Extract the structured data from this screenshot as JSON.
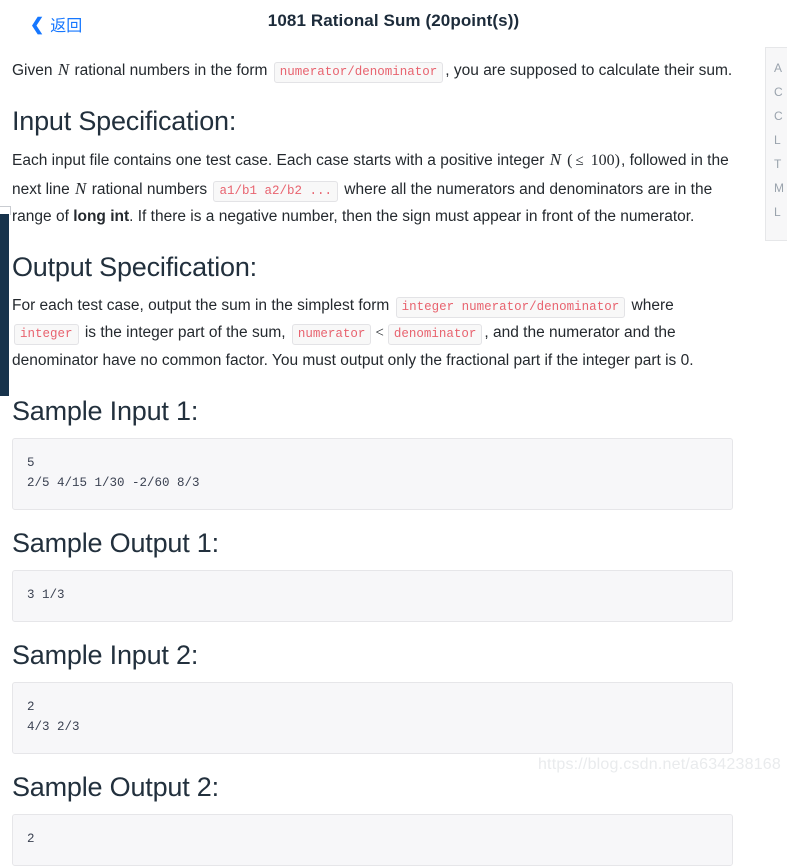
{
  "header": {
    "back_label": "返回",
    "back_icon": "chevron-left-icon",
    "title": "1081 Rational Sum (20point(s))"
  },
  "right_panel": {
    "items": [
      "A",
      "C",
      "C",
      "L",
      "T",
      "M",
      "L"
    ]
  },
  "content": {
    "intro": {
      "p1_a": "Given ",
      "p1_n": "N",
      "p1_b": " rational numbers in the form ",
      "p1_code": "numerator/denominator",
      "p1_c": ", you are supposed to calculate their sum."
    },
    "input_spec": {
      "heading": "Input Specification:",
      "a": "Each input file contains one test case. Each case starts with a positive integer ",
      "n1": "N",
      "b": " (",
      "le": "≤",
      "limit": " 100)",
      "c": ", followed in the next line ",
      "n2": "N",
      "d": " rational numbers ",
      "code": "a1/b1 a2/b2 ...",
      "e": " where all the numerators and denominators are in the range of ",
      "strong": "long int",
      "f": ". If there is a negative number, then the sign must appear in front of the numerator."
    },
    "output_spec": {
      "heading": "Output Specification:",
      "a": "For each test case, output the sum in the simplest form ",
      "code1": "integer numerator/denominator",
      "b": " where ",
      "code2": "integer",
      "c": " is the integer part of the sum, ",
      "code3": "numerator",
      "lt": "<",
      "code4": "denominator",
      "d": ", and the numerator and the denominator have no common factor. You must output only the fractional part if the integer part is 0."
    },
    "samples": [
      {
        "heading": "Sample Input 1:",
        "code": "5\n2/5 4/15 1/30 -2/60 8/3"
      },
      {
        "heading": "Sample Output 1:",
        "code": "3 1/3"
      },
      {
        "heading": "Sample Input 2:",
        "code": "2\n4/3 2/3"
      },
      {
        "heading": "Sample Output 2:",
        "code": "2"
      }
    ]
  },
  "watermark": {
    "text": "https://blog.csdn.net/a634238168"
  },
  "colors": {
    "accent_link": "#1677ff",
    "code_text": "#e8636f",
    "heading": "#22303d",
    "rail": "#17334c"
  }
}
